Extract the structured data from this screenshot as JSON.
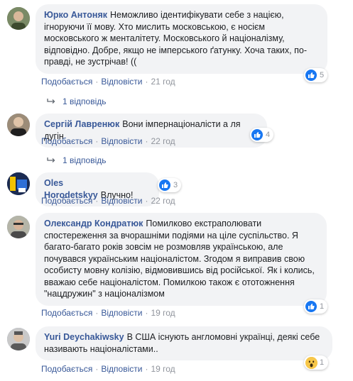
{
  "comments": [
    {
      "author": "Юрко Антоняк",
      "text": "Неможливо ідентифікувати себе з нацією, ігноруючи її мову. Хто мислить московською, є носієм московського ж менталітету. Московського й націоналізму, відповідно. Добре, якщо не імперського ґатунку. Хоча таких, по-правді, не зустрічав! ((",
      "like_label": "Подобається",
      "reply_label": "Відповісти",
      "time": "21 год",
      "reaction_count": "5",
      "replies": "1 відповідь"
    },
    {
      "author": "Сергій Лавренюк",
      "text": "Вони імпернаціоналісти а ля дугін",
      "like_label": "Подобається",
      "reply_label": "Відповісти",
      "time": "22 год",
      "reaction_count": "4",
      "replies": "1 відповідь"
    },
    {
      "author": "Oles Horodetskyy",
      "text": "Влучно!",
      "like_label": "Подобається",
      "reply_label": "Відповісти",
      "time": "22 год",
      "reaction_count": "3"
    },
    {
      "author": "Олександр Кондратюк",
      "text": "Помилково екстраполювати спостереження за вчорашніми подіями на ціле суспільство. Я багато-багато років зовсім не розмовляв українською, але почувався українським націоналістом. Згодом я виправив свою особисту мовну колізію, відмовившись від російської. Як і колись, вважаю себе націоналістом. Помилкою також є ототожнення \"нацдружин\" з націоналізмом",
      "like_label": "Подобається",
      "reply_label": "Відповісти",
      "time": "19 год",
      "reaction_count": "1"
    },
    {
      "author": "Yuri Deychakiwsky",
      "text": "В США існують англомовні українці, деякі себе називають націоналістами..",
      "like_label": "Подобається",
      "reply_label": "Відповісти",
      "time": "19 год",
      "reaction_count": "1"
    }
  ],
  "colors": {
    "link": "#385898",
    "muted": "#90949c",
    "bubble": "#f2f3f5",
    "like": "#1877f2",
    "wow": "#f7c74a"
  }
}
